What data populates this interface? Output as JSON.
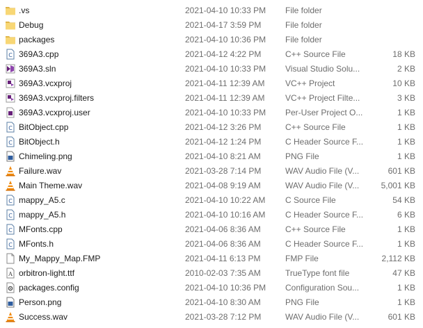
{
  "files": [
    {
      "name": ".vs",
      "date": "2021-04-10 10:33 PM",
      "type": "File folder",
      "size": "",
      "icon": "folder-icon"
    },
    {
      "name": "Debug",
      "date": "2021-04-17 3:59 PM",
      "type": "File folder",
      "size": "",
      "icon": "folder-icon"
    },
    {
      "name": "packages",
      "date": "2021-04-10 10:36 PM",
      "type": "File folder",
      "size": "",
      "icon": "folder-icon"
    },
    {
      "name": "369A3.cpp",
      "date": "2021-04-12 4:22 PM",
      "type": "C++ Source File",
      "size": "18 KB",
      "icon": "cpp-file-icon"
    },
    {
      "name": "369A3.sln",
      "date": "2021-04-10 10:33 PM",
      "type": "Visual Studio Solu...",
      "size": "2 KB",
      "icon": "sln-file-icon"
    },
    {
      "name": "369A3.vcxproj",
      "date": "2021-04-11 12:39 AM",
      "type": "VC++ Project",
      "size": "10 KB",
      "icon": "vcxproj-file-icon"
    },
    {
      "name": "369A3.vcxproj.filters",
      "date": "2021-04-11 12:39 AM",
      "type": "VC++ Project Filte...",
      "size": "3 KB",
      "icon": "vcxproj-file-icon"
    },
    {
      "name": "369A3.vcxproj.user",
      "date": "2021-04-10 10:33 PM",
      "type": "Per-User Project O...",
      "size": "1 KB",
      "icon": "user-project-file-icon"
    },
    {
      "name": "BitObject.cpp",
      "date": "2021-04-12 3:26 PM",
      "type": "C++ Source File",
      "size": "1 KB",
      "icon": "cpp-file-icon"
    },
    {
      "name": "BitObject.h",
      "date": "2021-04-12 1:24 PM",
      "type": "C Header Source F...",
      "size": "1 KB",
      "icon": "header-file-icon"
    },
    {
      "name": "Chimeling.png",
      "date": "2021-04-10 8:21 AM",
      "type": "PNG File",
      "size": "1 KB",
      "icon": "png-file-icon"
    },
    {
      "name": "Failure.wav",
      "date": "2021-03-28 7:14 PM",
      "type": "WAV Audio File (V...",
      "size": "601 KB",
      "icon": "vlc-cone-icon"
    },
    {
      "name": "Main Theme.wav",
      "date": "2021-04-08 9:19 AM",
      "type": "WAV Audio File (V...",
      "size": "5,001 KB",
      "icon": "vlc-cone-icon"
    },
    {
      "name": "mappy_A5.c",
      "date": "2021-04-10 10:22 AM",
      "type": "C Source File",
      "size": "54 KB",
      "icon": "c-file-icon"
    },
    {
      "name": "mappy_A5.h",
      "date": "2021-04-10 10:16 AM",
      "type": "C Header Source F...",
      "size": "6 KB",
      "icon": "header-file-icon"
    },
    {
      "name": "MFonts.cpp",
      "date": "2021-04-06 8:36 AM",
      "type": "C++ Source File",
      "size": "1 KB",
      "icon": "cpp-file-icon"
    },
    {
      "name": "MFonts.h",
      "date": "2021-04-06 8:36 AM",
      "type": "C Header Source F...",
      "size": "1 KB",
      "icon": "header-file-icon"
    },
    {
      "name": "My_Mappy_Map.FMP",
      "date": "2021-04-11 6:13 PM",
      "type": "FMP File",
      "size": "2,112 KB",
      "icon": "blank-file-icon"
    },
    {
      "name": "orbitron-light.ttf",
      "date": "2010-02-03 7:35 AM",
      "type": "TrueType font file",
      "size": "47 KB",
      "icon": "font-file-icon"
    },
    {
      "name": "packages.config",
      "date": "2021-04-10 10:36 PM",
      "type": "Configuration Sou...",
      "size": "1 KB",
      "icon": "config-file-icon"
    },
    {
      "name": "Person.png",
      "date": "2021-04-10 8:30 AM",
      "type": "PNG File",
      "size": "1 KB",
      "icon": "png-file-icon"
    },
    {
      "name": "Success.wav",
      "date": "2021-03-28 7:12 PM",
      "type": "WAV Audio File (V...",
      "size": "601 KB",
      "icon": "vlc-cone-icon"
    }
  ],
  "colors": {
    "folder": "#f8d775",
    "folder_dark": "#e0b548",
    "code_border": "#5b7fa6",
    "vs_purple": "#68217a",
    "vlc_orange": "#f08a0c"
  }
}
